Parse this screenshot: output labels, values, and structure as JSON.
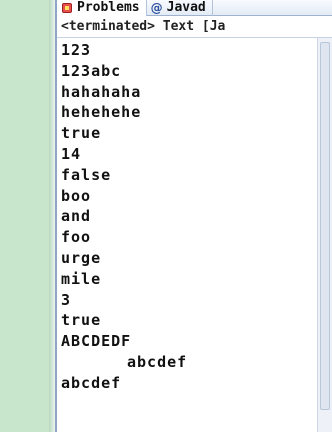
{
  "tabs": [
    {
      "label": "Problems",
      "icon": "problems-icon"
    },
    {
      "label": "Javad",
      "icon": "javadoc-icon",
      "icon_glyph": "@"
    }
  ],
  "console_header": "<terminated> Text [Ja",
  "output_lines": [
    {
      "text": "123",
      "indent": false
    },
    {
      "text": "123abc",
      "indent": false
    },
    {
      "text": "hahahaha",
      "indent": false
    },
    {
      "text": "hehehehe",
      "indent": false
    },
    {
      "text": "true",
      "indent": false
    },
    {
      "text": "14",
      "indent": false
    },
    {
      "text": "false",
      "indent": false
    },
    {
      "text": "boo",
      "indent": false
    },
    {
      "text": "and",
      "indent": false
    },
    {
      "text": "foo",
      "indent": false
    },
    {
      "text": "urge",
      "indent": false
    },
    {
      "text": "mile",
      "indent": false
    },
    {
      "text": "3",
      "indent": false
    },
    {
      "text": "true",
      "indent": false
    },
    {
      "text": "ABCDEDF",
      "indent": false
    },
    {
      "text": "abcdef",
      "indent": true
    },
    {
      "text": "abcdef",
      "indent": false
    }
  ],
  "colors": {
    "background": "#ffffff",
    "left_gutter": "#c7e6cc",
    "text": "#111111"
  }
}
